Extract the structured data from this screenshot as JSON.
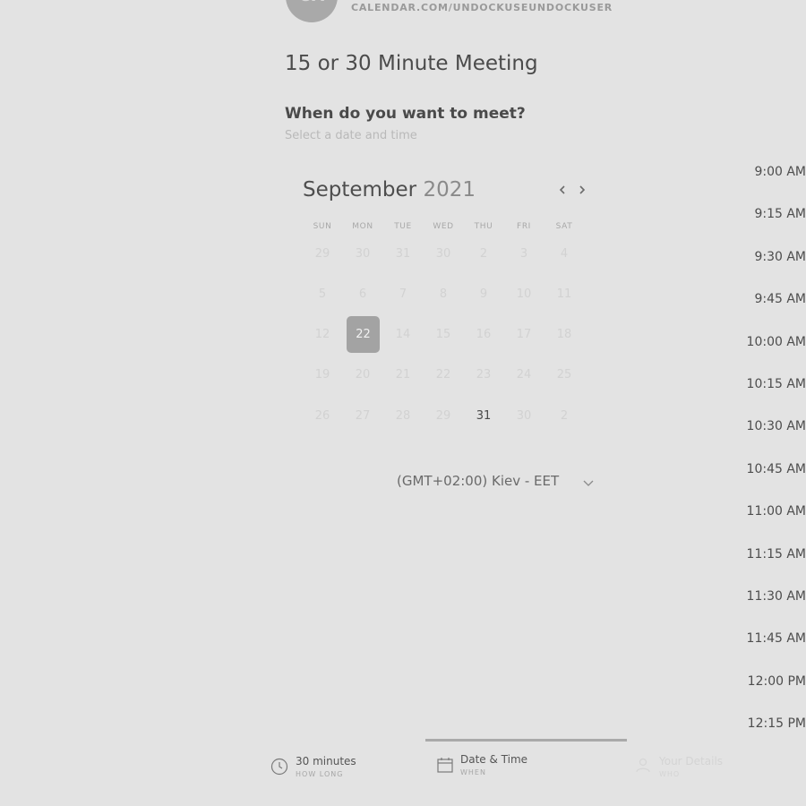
{
  "header": {
    "avatar_initials": "UA",
    "calendar_url": "CALENDAR.COM/UNDOCKUSEUNDOCKUSER",
    "meeting_title": "15 or 30 Minute Meeting"
  },
  "prompt": {
    "question": "When do you want to meet?",
    "subtitle": "Select a date and time"
  },
  "calendar": {
    "month": "September",
    "year": "2021",
    "prev_icon": "chevron-left-icon",
    "next_icon": "chevron-right-icon",
    "weekdays": [
      "SUN",
      "MON",
      "TUE",
      "WED",
      "THU",
      "FRI",
      "SAT"
    ],
    "weeks": [
      [
        "29",
        "30",
        "31",
        "30",
        "2",
        "3",
        "4"
      ],
      [
        "5",
        "6",
        "7",
        "8",
        "9",
        "10",
        "11"
      ],
      [
        "12",
        "22",
        "14",
        "15",
        "16",
        "17",
        "18"
      ],
      [
        "19",
        "20",
        "21",
        "22",
        "23",
        "24",
        "25"
      ],
      [
        "26",
        "27",
        "28",
        "29",
        "31",
        "30",
        "2"
      ]
    ],
    "selected_day": "22",
    "available_day": "31"
  },
  "timezone": {
    "label": "(GMT+02:00) Kiev - EET",
    "icon": "chevron-down-icon"
  },
  "time_slots": [
    "9:00 AM",
    "9:15 AM",
    "9:30 AM",
    "9:45 AM",
    "10:00 AM",
    "10:15 AM",
    "10:30 AM",
    "10:45 AM",
    "11:00 AM",
    "11:15 AM",
    "11:30 AM",
    "11:45 AM",
    "12:00 PM",
    "12:15 PM"
  ],
  "steps": [
    {
      "label": "30 minutes",
      "sub": "HOW LONG",
      "icon": "clock-icon"
    },
    {
      "label": "Date & Time",
      "sub": "WHEN",
      "icon": "calendar-icon"
    },
    {
      "label": "Your Details",
      "sub": "WHO",
      "icon": "user-icon"
    }
  ],
  "colors": {
    "background": "#e3e3e3",
    "selected": "#a3a3a3",
    "active_step": "#a9a9a9"
  }
}
